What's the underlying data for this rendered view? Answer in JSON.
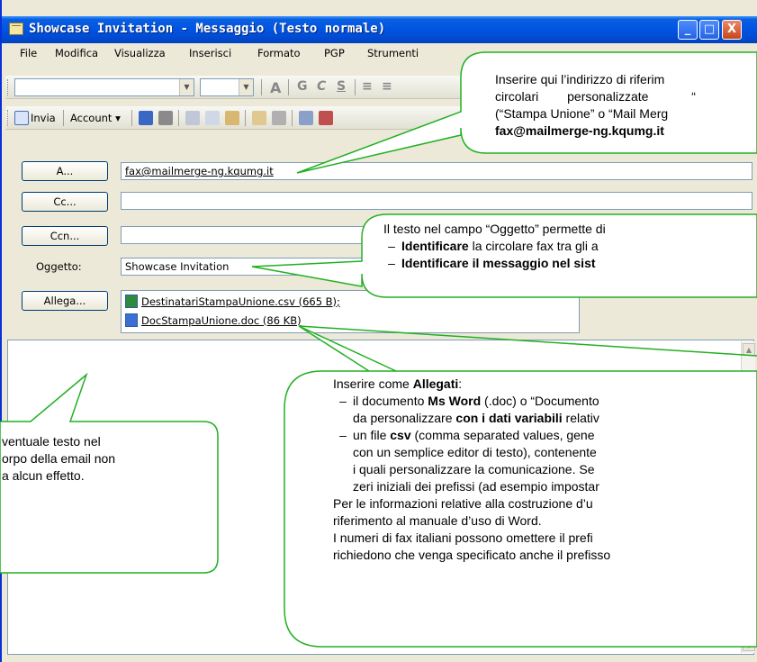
{
  "window": {
    "title": "Showcase Invitation - Messaggio (Testo normale)",
    "controls": {
      "minimize": "_",
      "maximize": "□",
      "close": "X"
    }
  },
  "menu": [
    "File",
    "Modifica",
    "Visualizza",
    "Inserisci",
    "Formato",
    "PGP",
    "Strumenti"
  ],
  "toolbar_format": {
    "glyphs": [
      "A",
      "G",
      "C",
      "S",
      "≡",
      "≡"
    ]
  },
  "toolbar_standard": {
    "send_label": "Invia",
    "account_label": "Account ▾"
  },
  "fields": {
    "to_button": "A...",
    "to_value": "fax@mailmerge-ng.kqumg.it",
    "cc_button": "Cc...",
    "bcc_button": "Ccn...",
    "subject_label": "Oggetto:",
    "subject_value": "Showcase Invitation",
    "attach_button": "Allega...",
    "attachments": [
      "DestinatariStampaUnione.csv (665 B);",
      "DocStampaUnione.doc (86 KB)"
    ]
  },
  "callouts": {
    "address": {
      "line1": "Inserire qui l’indirizzo di riferim",
      "line2a": "circolari",
      "line2b": "personalizzate",
      "line2c": "“",
      "line3": "(“Stampa Unione” o “Mail Merg",
      "line4": "fax@mailmerge-ng.kqumg.it"
    },
    "subject": {
      "line1": "Il testo nel campo “Oggetto” permette di",
      "bullet1_bold": "Identificare",
      "bullet1_rest": " la circolare fax tra gli a",
      "bullet2_bold": "Identificare il messaggio nel sist"
    },
    "body_note": {
      "line1": "ventuale testo nel",
      "line2": "orpo della email non",
      "line3": "a alcun effetto."
    },
    "attachments": {
      "intro": "Inserire come ",
      "intro_bold": "Allegati",
      "intro_end": ":",
      "b1_l1a": "il documento ",
      "b1_l1b": "Ms Word",
      "b1_l1c": " (.doc) o “Documento",
      "b1_l2a": "da personalizzare ",
      "b1_l2b": "con i dati variabili",
      "b1_l2c": " relativ",
      "b2_l1a": "un file ",
      "b2_l1b": "csv",
      "b2_l1c": " (comma separated values, gene",
      "b2_l2": "con un semplice editor di testo), contenente",
      "b2_l3": "i quali personalizzare la comunicazione. Se",
      "b2_l4": "zeri iniziali dei prefissi (ad esempio impostar",
      "p2_l1": "Per le informazioni relative alla costruzione d’u",
      "p2_l2": "riferimento al manuale d’uso di Word.",
      "p3_l1": "I numeri di fax italiani possono omettere il prefi",
      "p3_l2": "richiedono che venga specificato anche il prefisso"
    },
    "dash": "–"
  }
}
